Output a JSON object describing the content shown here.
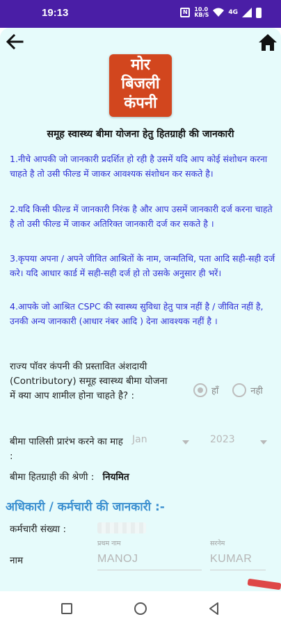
{
  "status_bar": {
    "time": "19:13",
    "net_top": "10.0",
    "net_bottom": "KB/S",
    "signal": "4G"
  },
  "header": {
    "back_icon": "arrow-left-icon",
    "home_icon": "home-icon"
  },
  "logo": {
    "line1": "मोर",
    "line2": "बिजली",
    "line3": "कंपनी",
    "color": "#d2461e"
  },
  "page": {
    "title": "समूह स्वास्थ्य बीमा योजना हेतु हितग्राही की जानकारी"
  },
  "notes": [
    "1.नीचे आपकी जो जानकारी प्रदर्शित हो रही है उसमें यदि आप कोई संशोधन करना चाहते है तो उसी फील्ड में जाकर आवश्यक संशोधन कर सकते है।",
    "2.यदि किसी फील्ड में जानकारी निरंक है और आप उसमें जानकारी दर्ज करना चाहते है तो उसी फील्ड में जाकर अतिरिक्त जानकारी दर्ज कर सकते है ।",
    "3.कृपया अपना / अपने जीवित आश्रितों के नाम, जन्मतिथि, पता आदि सही-सही दर्ज करे। यदि आधार कार्ड में सही-सही दर्ज हो तो उसके अनुसार ही भरें।",
    "4.आपके जो आश्रित CSPC की स्वास्थ्य सुविधा हेतु पात्र नहीं है / जीवित नहीं है, उनकी अन्य जानकारी (आधार नंबर आदि ) देना आवश्यक नहीं है ।"
  ],
  "question": {
    "label": "राज्य पॉवर कंपनी की प्रस्तावित अंशदायी (Contributory) समूह स्वास्थ्य बीमा योजना में क्या आप शामील होना चाहते है? :",
    "options": [
      {
        "label": "हाँ",
        "checked": true
      },
      {
        "label": "नही",
        "checked": false
      }
    ]
  },
  "policy": {
    "label": "बीमा पालिसी प्रारंभ करने का माह :",
    "month": "Jan",
    "year": "2023"
  },
  "category": {
    "label": "बीमा हितग्राही की श्रेणी :",
    "value": "नियमित"
  },
  "employee_section": {
    "heading": "अधिकारी / कर्मचारी की जानकारी :-",
    "emp_no_label": "कर्मचारी संख्या :",
    "first_name_hint": "प्रथम नाम",
    "last_name_hint": "सरनेम",
    "name_label": "नाम",
    "first_name": "MANOJ",
    "last_name": "KUMAR"
  },
  "colors": {
    "status_bar": "#4a1ea6",
    "background": "#e6fbfb",
    "note_text": "#2c2cd6",
    "section_heading": "#3a8fd0"
  }
}
